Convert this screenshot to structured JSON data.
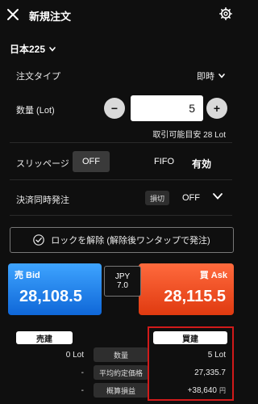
{
  "header": {
    "title": "新規注文"
  },
  "symbol": {
    "name": "日本225"
  },
  "order_type": {
    "label": "注文タイプ",
    "value": "即時"
  },
  "quantity": {
    "label": "数量 (Lot)",
    "value": "5",
    "available": "取引可能目安 28 Lot"
  },
  "slippage": {
    "label": "スリッページ",
    "state": "OFF",
    "fifo": "FIFO",
    "valid": "有効"
  },
  "settle": {
    "label": "決済同時発注",
    "badge": "損切",
    "state": "OFF"
  },
  "lock_button": {
    "label": "ロックを解除 (解除後ワンタップで発注)"
  },
  "bid": {
    "label": "売 Bid",
    "price": "28,108.5"
  },
  "ask": {
    "label": "買 Ask",
    "price": "28,115.5"
  },
  "spread": {
    "currency": "JPY",
    "value": "7.0"
  },
  "positions": {
    "sell_header": "売建",
    "buy_header": "買建",
    "rows": [
      {
        "label": "数量",
        "sell": "0 Lot",
        "buy": "5 Lot"
      },
      {
        "label": "平均約定価格",
        "sell": "-",
        "buy": "27,335.7"
      },
      {
        "label": "概算損益",
        "sell": "-",
        "buy": "+38,640",
        "buy_unit": "円"
      }
    ]
  },
  "colors": {
    "background": "#0f0f0f",
    "bid": "#1f7ff0",
    "ask": "#ef4b1f",
    "highlight": "#d11a1a"
  }
}
